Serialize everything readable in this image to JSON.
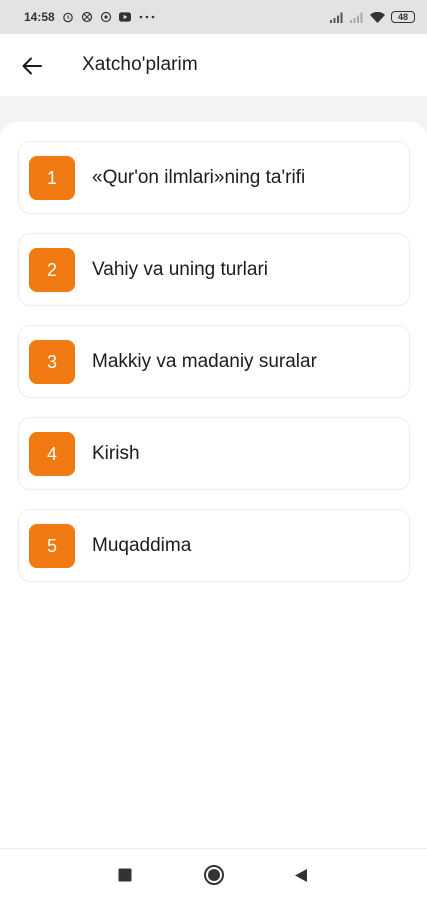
{
  "status_bar": {
    "time": "14:58",
    "left_icons": [
      "alarm-icon",
      "fan-icon",
      "sync-icon",
      "youtube-icon",
      "more-dots-icon"
    ],
    "battery": "48"
  },
  "app_bar": {
    "back_icon": "arrow-left-icon",
    "title": "Xatcho'plarim"
  },
  "items": [
    {
      "number": "1",
      "label": "«Qur'on ilmlari»ning ta'rifi"
    },
    {
      "number": "2",
      "label": "Vahiy va uning turlari"
    },
    {
      "number": "3",
      "label": "Makkiy va madaniy suralar"
    },
    {
      "number": "4",
      "label": "Kirish"
    },
    {
      "number": "5",
      "label": "Muqaddima"
    }
  ],
  "nav_bar": {
    "recent_icon": "square-icon",
    "home_icon": "circle-icon",
    "back_icon": "triangle-back-icon"
  },
  "colors": {
    "accent": "#f07a11",
    "background": "#ffffff",
    "band": "#f3f3f3",
    "status_bar": "#e3e3e3"
  }
}
